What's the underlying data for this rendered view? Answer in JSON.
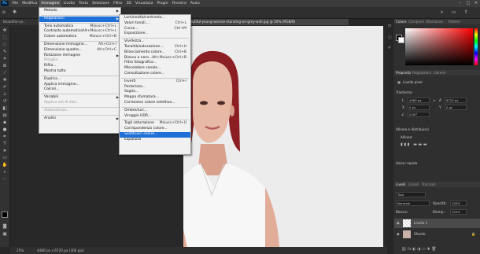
{
  "app": {
    "logo": "Ps",
    "accent": "#31a8ff",
    "menubar": [
      "File",
      "Modifica",
      "Immagine",
      "Livello",
      "Testo",
      "Selezione",
      "Filtro",
      "3D",
      "Visualizza",
      "Plugin",
      "Finestra",
      "Aiuto"
    ],
    "active_menu": "Immagine",
    "window_controls": [
      "minimize-icon",
      "maximize-icon",
      "close-icon"
    ]
  },
  "tabs": [
    {
      "label": "beautiful-yo...",
      "active": false
    },
    {
      "label": "portrait-of-beautiful-young-woman-standing-on-grey-wall.jpg @ 50% (RGB/8)",
      "active": true
    }
  ],
  "status": {
    "zoom": "25%",
    "doc_info": "4480 px x 6720 px (300 ppi)"
  },
  "image_menu": {
    "items": [
      {
        "label": "Metodo",
        "submenu": true
      },
      {
        "sep": true
      },
      {
        "label": "Regolazioni",
        "submenu": true,
        "highlighted": true
      },
      {
        "sep": true
      },
      {
        "label": "Tono automatico",
        "shortcut": "Maiusc+Ctrl+L"
      },
      {
        "label": "Contrasto automatico",
        "shortcut": "Alt+Maiusc+Ctrl+L"
      },
      {
        "label": "Colore automatico",
        "shortcut": "Maiusc+Ctrl+B"
      },
      {
        "sep": true
      },
      {
        "label": "Dimensione immagine...",
        "shortcut": "Alt+Ctrl+I"
      },
      {
        "label": "Dimensione quadro...",
        "shortcut": "Alt+Ctrl+C"
      },
      {
        "label": "Rotazione immagine",
        "submenu": true
      },
      {
        "label": "Ritaglia",
        "disabled": true
      },
      {
        "label": "Rifila..."
      },
      {
        "label": "Mostra tutto"
      },
      {
        "sep": true
      },
      {
        "label": "Duplica..."
      },
      {
        "label": "Applica immagine..."
      },
      {
        "label": "Calcoli..."
      },
      {
        "sep": true
      },
      {
        "label": "Variabili",
        "submenu": true
      },
      {
        "label": "Applica set di dati...",
        "disabled": true
      },
      {
        "sep": true
      },
      {
        "label": "Abbondanza...",
        "disabled": true
      },
      {
        "sep": true
      },
      {
        "label": "Analisi",
        "submenu": true
      }
    ]
  },
  "adjust_menu": {
    "items": [
      {
        "label": "Luminosità/contrasto..."
      },
      {
        "label": "Valori tonali...",
        "shortcut": "Ctrl+L"
      },
      {
        "label": "Curve...",
        "shortcut": "Ctrl+M"
      },
      {
        "label": "Esposizione..."
      },
      {
        "sep": true
      },
      {
        "label": "Vividezza..."
      },
      {
        "label": "Tonalità/saturazione...",
        "shortcut": "Ctrl+U"
      },
      {
        "label": "Bilanciamento colore...",
        "shortcut": "Ctrl+B"
      },
      {
        "label": "Bianco e nero...",
        "shortcut": "Alt+Maiusc+Ctrl+B"
      },
      {
        "label": "Filtro fotografico..."
      },
      {
        "label": "Miscelatore canale..."
      },
      {
        "label": "Consultazione colore..."
      },
      {
        "sep": true
      },
      {
        "label": "Inverti",
        "shortcut": "Ctrl+I"
      },
      {
        "label": "Posterizza..."
      },
      {
        "label": "Soglia..."
      },
      {
        "label": "Mappa sfumatura..."
      },
      {
        "label": "Correzione colore selettiva..."
      },
      {
        "sep": true
      },
      {
        "label": "Ombre/luci..."
      },
      {
        "label": "Viraggio HDR..."
      },
      {
        "sep": true
      },
      {
        "label": "Togli saturazione",
        "shortcut": "Maiusc+Ctrl+U"
      },
      {
        "label": "Corrispondenza colore..."
      },
      {
        "label": "Sostituisci colore...",
        "highlighted": true
      },
      {
        "label": "Equalizza"
      }
    ]
  },
  "panels": {
    "color_tabs": [
      "Colore",
      "Campioni",
      "Sfumature",
      "Pattern"
    ],
    "props_tabs": [
      "Proprietà",
      "Regolazioni",
      "Librerie"
    ],
    "layer_kind": "Livello pixel",
    "transform_title": "Trasforma",
    "transform": {
      "w_label": "L",
      "w": "4480 px",
      "h_label": "A",
      "h": "6720 px",
      "x_label": "X",
      "x": "0 px",
      "y_label": "Y",
      "y": "0 px",
      "angle": "0,00°"
    },
    "align_title": "Allinea e distribuisci",
    "align_label": "Allinea:",
    "quick_title": "Azioni rapide",
    "layers_tabs": [
      "Livelli",
      "Canali",
      "Tracciati"
    ],
    "kind_filter": "Tipo",
    "blend_mode": "Normale",
    "opacity_label": "Opacità:",
    "opacity": "100%",
    "lock_label": "Blocca:",
    "fill_label": "Riemp.:",
    "fill": "100%",
    "layers": [
      {
        "name": "Livello 1",
        "selected": true
      },
      {
        "name": "Sfondo",
        "selected": false
      }
    ]
  }
}
